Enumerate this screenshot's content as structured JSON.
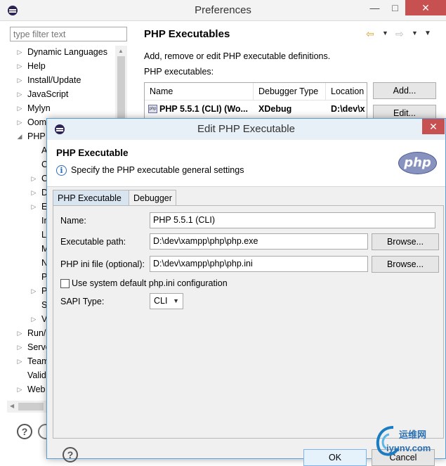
{
  "preferences": {
    "title": "Preferences",
    "filter_placeholder": "type filter text",
    "tree": [
      {
        "label": "Dynamic Languages",
        "indent": 0,
        "state": "collapsed"
      },
      {
        "label": "Help",
        "indent": 0,
        "state": "collapsed"
      },
      {
        "label": "Install/Update",
        "indent": 0,
        "state": "collapsed"
      },
      {
        "label": "JavaScript",
        "indent": 0,
        "state": "collapsed"
      },
      {
        "label": "Mylyn",
        "indent": 0,
        "state": "collapsed"
      },
      {
        "label": "Oom",
        "indent": 0,
        "state": "collapsed"
      },
      {
        "label": "PHP",
        "indent": 0,
        "state": "expanded"
      },
      {
        "label": "A",
        "indent": 1,
        "state": "leaf"
      },
      {
        "label": "C",
        "indent": 1,
        "state": "leaf"
      },
      {
        "label": "C",
        "indent": 1,
        "state": "collapsed"
      },
      {
        "label": "D",
        "indent": 1,
        "state": "collapsed"
      },
      {
        "label": "E",
        "indent": 1,
        "state": "collapsed"
      },
      {
        "label": "In",
        "indent": 1,
        "state": "leaf"
      },
      {
        "label": "Li",
        "indent": 1,
        "state": "leaf"
      },
      {
        "label": "M",
        "indent": 1,
        "state": "leaf"
      },
      {
        "label": "N",
        "indent": 1,
        "state": "leaf"
      },
      {
        "label": "P",
        "indent": 1,
        "state": "leaf"
      },
      {
        "label": "P",
        "indent": 1,
        "state": "collapsed"
      },
      {
        "label": "S",
        "indent": 1,
        "state": "leaf"
      },
      {
        "label": "V",
        "indent": 1,
        "state": "collapsed"
      },
      {
        "label": "Run/",
        "indent": 0,
        "state": "collapsed"
      },
      {
        "label": "Serve",
        "indent": 0,
        "state": "collapsed"
      },
      {
        "label": "Team",
        "indent": 0,
        "state": "collapsed"
      },
      {
        "label": "Valid",
        "indent": 0,
        "state": "leaf"
      },
      {
        "label": "Web",
        "indent": 0,
        "state": "collapsed"
      }
    ],
    "page_title": "PHP Executables",
    "page_description": "Add, remove or edit PHP executable definitions.",
    "executables_label": "PHP executables:",
    "table": {
      "columns": [
        "Name",
        "Debugger Type",
        "Location"
      ],
      "rows": [
        [
          "PHP 5.5.1 (CLI) (Wo...",
          "XDebug",
          "D:\\dev\\x"
        ]
      ]
    },
    "add_button": "Add...",
    "edit_button": "Edit...",
    "help_glyph": "?"
  },
  "dialog": {
    "title": "Edit PHP Executable",
    "heading": "PHP Executable",
    "subtitle": "Specify the PHP executable general settings",
    "logo_text": "php",
    "tabs": [
      "PHP Executable",
      "Debugger"
    ],
    "name_label": "Name:",
    "name_value": "PHP 5.5.1 (CLI)",
    "path_label": "Executable path:",
    "path_value": "D:\\dev\\xampp\\php\\php.exe",
    "ini_label": "PHP ini file (optional):",
    "ini_value": "D:\\dev\\xampp\\php\\php.ini",
    "browse_label": "Browse...",
    "checkbox_label": "Use system default php.ini configuration",
    "checkbox_checked": false,
    "sapi_label": "SAPI Type:",
    "sapi_value": "CLI",
    "ok_label": "OK",
    "cancel_label": "Cancel"
  },
  "watermark": {
    "line1": "运维网",
    "line2": "iyunv.com"
  }
}
